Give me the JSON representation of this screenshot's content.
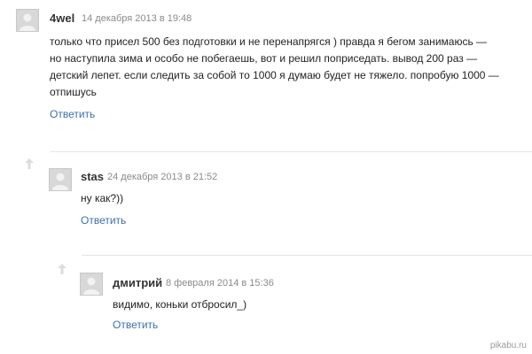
{
  "comments": [
    {
      "author": "4wel",
      "date": "14 декабря 2013 в 19:48",
      "lines": [
        "только что присел 500 без подготовки и не перенапрягся ) правда я бегом занимаюсь —",
        "но наступила зима и особо не побегаешь, вот и решил поприседать. вывод 200 раз —",
        "детский лепет. если следить за собой то 1000 я думаю будет не тяжело. попробую 1000 —",
        "отпишусь"
      ],
      "reply_label": "Ответить"
    },
    {
      "author": "stas",
      "date": "24 декабря 2013 в 21:52",
      "lines": [
        "ну как?))"
      ],
      "reply_label": "Ответить"
    },
    {
      "author": "дмитрий",
      "date": "8 февраля 2014 в 15:36",
      "lines": [
        "видимо, коньки отбросил_)"
      ],
      "reply_label": "Ответить"
    }
  ],
  "watermark": "pikabu.ru",
  "colors": {
    "link": "#3b6fb0",
    "date": "#8a8a8a",
    "avatar": "#d8d8d8",
    "divider": "#e4e4e4"
  }
}
